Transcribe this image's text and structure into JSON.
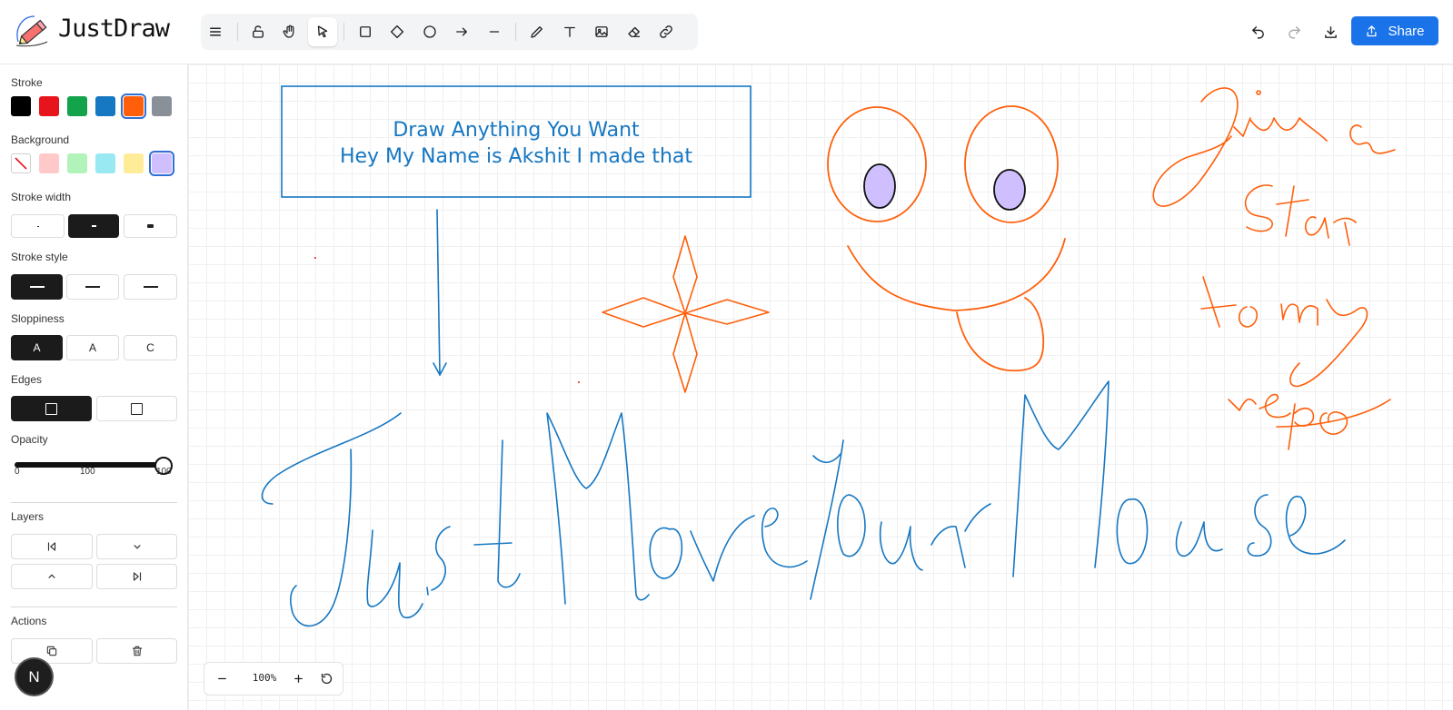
{
  "app": {
    "name": "JustDraw"
  },
  "toolbar": {
    "tools": [
      {
        "name": "menu-icon",
        "active": false
      },
      {
        "name": "lock-icon",
        "active": false
      },
      {
        "name": "hand-icon",
        "active": false
      },
      {
        "name": "pointer-icon",
        "active": true
      },
      {
        "name": "rectangle-icon",
        "active": false
      },
      {
        "name": "diamond-icon",
        "active": false
      },
      {
        "name": "circle-icon",
        "active": false
      },
      {
        "name": "arrow-icon",
        "active": false
      },
      {
        "name": "line-icon",
        "active": false
      },
      {
        "name": "pencil-icon",
        "active": false
      },
      {
        "name": "text-icon",
        "active": false
      },
      {
        "name": "image-icon",
        "active": false
      },
      {
        "name": "eraser-icon",
        "active": false
      },
      {
        "name": "link-icon",
        "active": false
      }
    ]
  },
  "header": {
    "share_label": "Share"
  },
  "sidebar": {
    "stroke_label": "Stroke",
    "stroke_colors": [
      "#000000",
      "#e8141b",
      "#12a34b",
      "#1677c2",
      "#ff5f0a",
      "#8a9098"
    ],
    "stroke_selected": "#ff5f0a",
    "background_label": "Background",
    "background_colors": [
      "transparent",
      "#ffc9c9",
      "#b2f2bb",
      "#99e9f2",
      "#ffec99",
      "#d0bfff"
    ],
    "background_selected": "#d0bfff",
    "stroke_width_label": "Stroke width",
    "stroke_style_label": "Stroke style",
    "sloppiness_label": "Sloppiness",
    "sloppiness_options": [
      "A",
      "A",
      "C"
    ],
    "edges_label": "Edges",
    "opacity_label": "Opacity",
    "opacity_min": "0",
    "opacity_mid": "100",
    "opacity_value": "100",
    "layers_label": "Layers",
    "actions_label": "Actions"
  },
  "canvas": {
    "textbox_line1": "Draw Anything You Want",
    "textbox_line2": "Hey My Name is Akshit I made that",
    "accent_blue": "#1677c2",
    "accent_orange": "#ff5f0a"
  },
  "zoom": {
    "value": "100%"
  },
  "user": {
    "initial": "N"
  }
}
